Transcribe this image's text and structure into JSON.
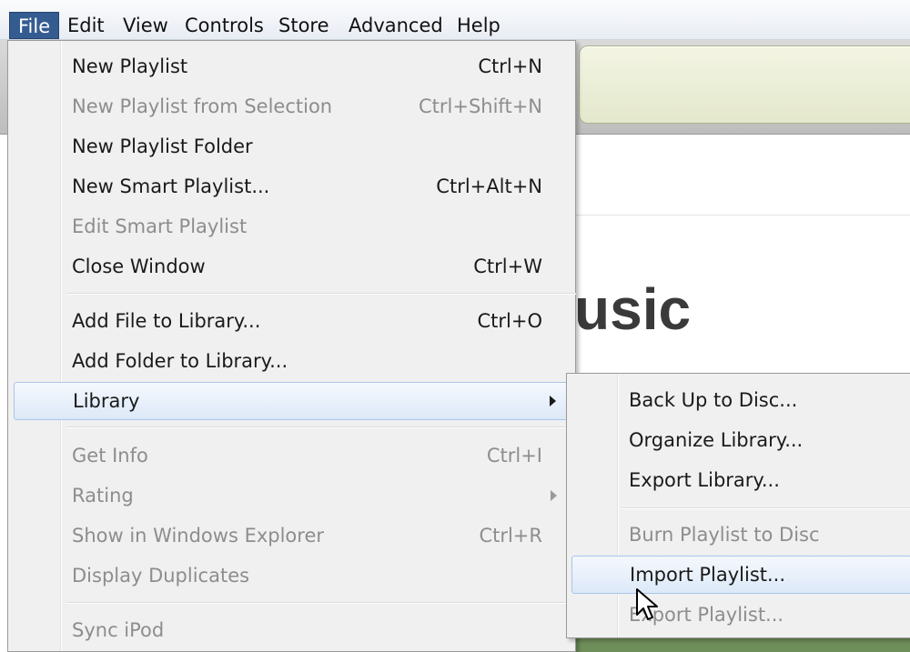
{
  "app": {
    "content_heading": "usic"
  },
  "menubar": {
    "items": [
      {
        "label": "File",
        "active": true
      },
      {
        "label": "Edit"
      },
      {
        "label": "View"
      },
      {
        "label": "Controls"
      },
      {
        "label": "Store"
      },
      {
        "label": "Advanced"
      },
      {
        "label": "Help"
      }
    ]
  },
  "file_menu": {
    "new_playlist": {
      "label": "New Playlist",
      "shortcut": "Ctrl+N"
    },
    "new_playlist_from_selection": {
      "label": "New Playlist from Selection",
      "shortcut": "Ctrl+Shift+N"
    },
    "new_playlist_folder": {
      "label": "New Playlist Folder"
    },
    "new_smart_playlist": {
      "label": "New Smart Playlist...",
      "shortcut": "Ctrl+Alt+N"
    },
    "edit_smart_playlist": {
      "label": "Edit Smart Playlist"
    },
    "close_window": {
      "label": "Close Window",
      "shortcut": "Ctrl+W"
    },
    "add_file": {
      "label": "Add File to Library...",
      "shortcut": "Ctrl+O"
    },
    "add_folder": {
      "label": "Add Folder to Library..."
    },
    "library": {
      "label": "Library"
    },
    "get_info": {
      "label": "Get Info",
      "shortcut": "Ctrl+I"
    },
    "rating": {
      "label": "Rating"
    },
    "show_in_explorer": {
      "label": "Show in Windows Explorer",
      "shortcut": "Ctrl+R"
    },
    "display_duplicates": {
      "label": "Display Duplicates"
    },
    "sync_ipod": {
      "label": "Sync iPod"
    }
  },
  "library_submenu": {
    "back_up": {
      "label": "Back Up to Disc..."
    },
    "organize": {
      "label": "Organize Library..."
    },
    "export_library": {
      "label": "Export Library..."
    },
    "burn_playlist": {
      "label": "Burn Playlist to Disc"
    },
    "import_playlist": {
      "label": "Import Playlist..."
    },
    "export_playlist": {
      "label": "Export Playlist..."
    }
  },
  "colors": {
    "menubar_active": "#355c91",
    "highlight_border": "#a8c5ea",
    "disabled_text": "#8d8d8d"
  }
}
